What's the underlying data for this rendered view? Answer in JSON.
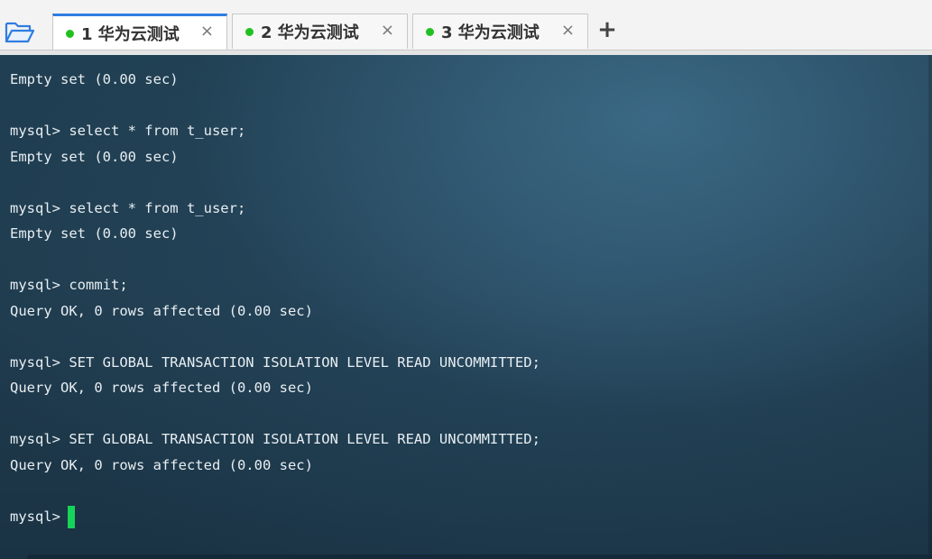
{
  "tabs": [
    {
      "label": "1 华为云测试",
      "status_color": "#21c021",
      "active": true,
      "close_icon": "×"
    },
    {
      "label": "2 华为云测试",
      "status_color": "#21c021",
      "active": false,
      "close_icon": "×"
    },
    {
      "label": "3 华为云测试",
      "status_color": "#21c021",
      "active": false,
      "close_icon": "×"
    }
  ],
  "toolbar": {
    "open_icon": "folder-open-icon",
    "add_tab_glyph": "+"
  },
  "terminal": {
    "lines": [
      "Empty set (0.00 sec)",
      "",
      "mysql> select * from t_user;",
      "Empty set (0.00 sec)",
      "",
      "mysql> select * from t_user;",
      "Empty set (0.00 sec)",
      "",
      "mysql> commit;",
      "Query OK, 0 rows affected (0.00 sec)",
      "",
      "mysql> SET GLOBAL TRANSACTION ISOLATION LEVEL READ UNCOMMITTED;",
      "Query OK, 0 rows affected (0.00 sec)",
      "",
      "mysql> SET GLOBAL TRANSACTION ISOLATION LEVEL READ UNCOMMITTED;",
      "Query OK, 0 rows affected (0.00 sec)",
      ""
    ],
    "prompt": "mysql>",
    "cursor_color": "#16d45a"
  }
}
